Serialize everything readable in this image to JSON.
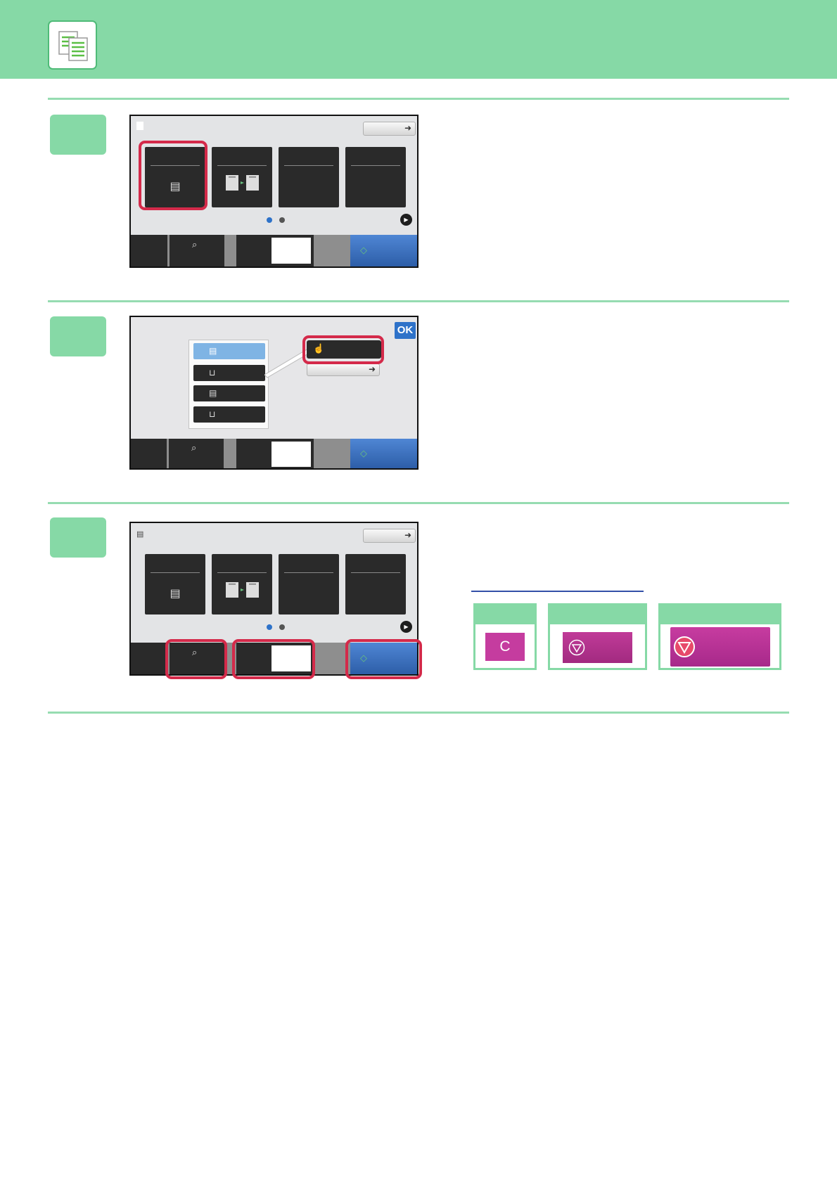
{
  "header": {
    "icon": "copy-document-icon"
  },
  "steps": [
    {
      "number": "",
      "panel": "copy-home"
    },
    {
      "number": "",
      "panel": "paper-select"
    },
    {
      "number": "",
      "panel": "copy-home-start"
    }
  ],
  "keys": {
    "clear_label": "C"
  },
  "colors": {
    "accent_green": "#86d9a6",
    "highlight_red": "#d42a4a",
    "start_blue": "#2d5ea8",
    "stop_magenta": "#b33497"
  },
  "panel_ui": {
    "ok_label": "OK"
  }
}
